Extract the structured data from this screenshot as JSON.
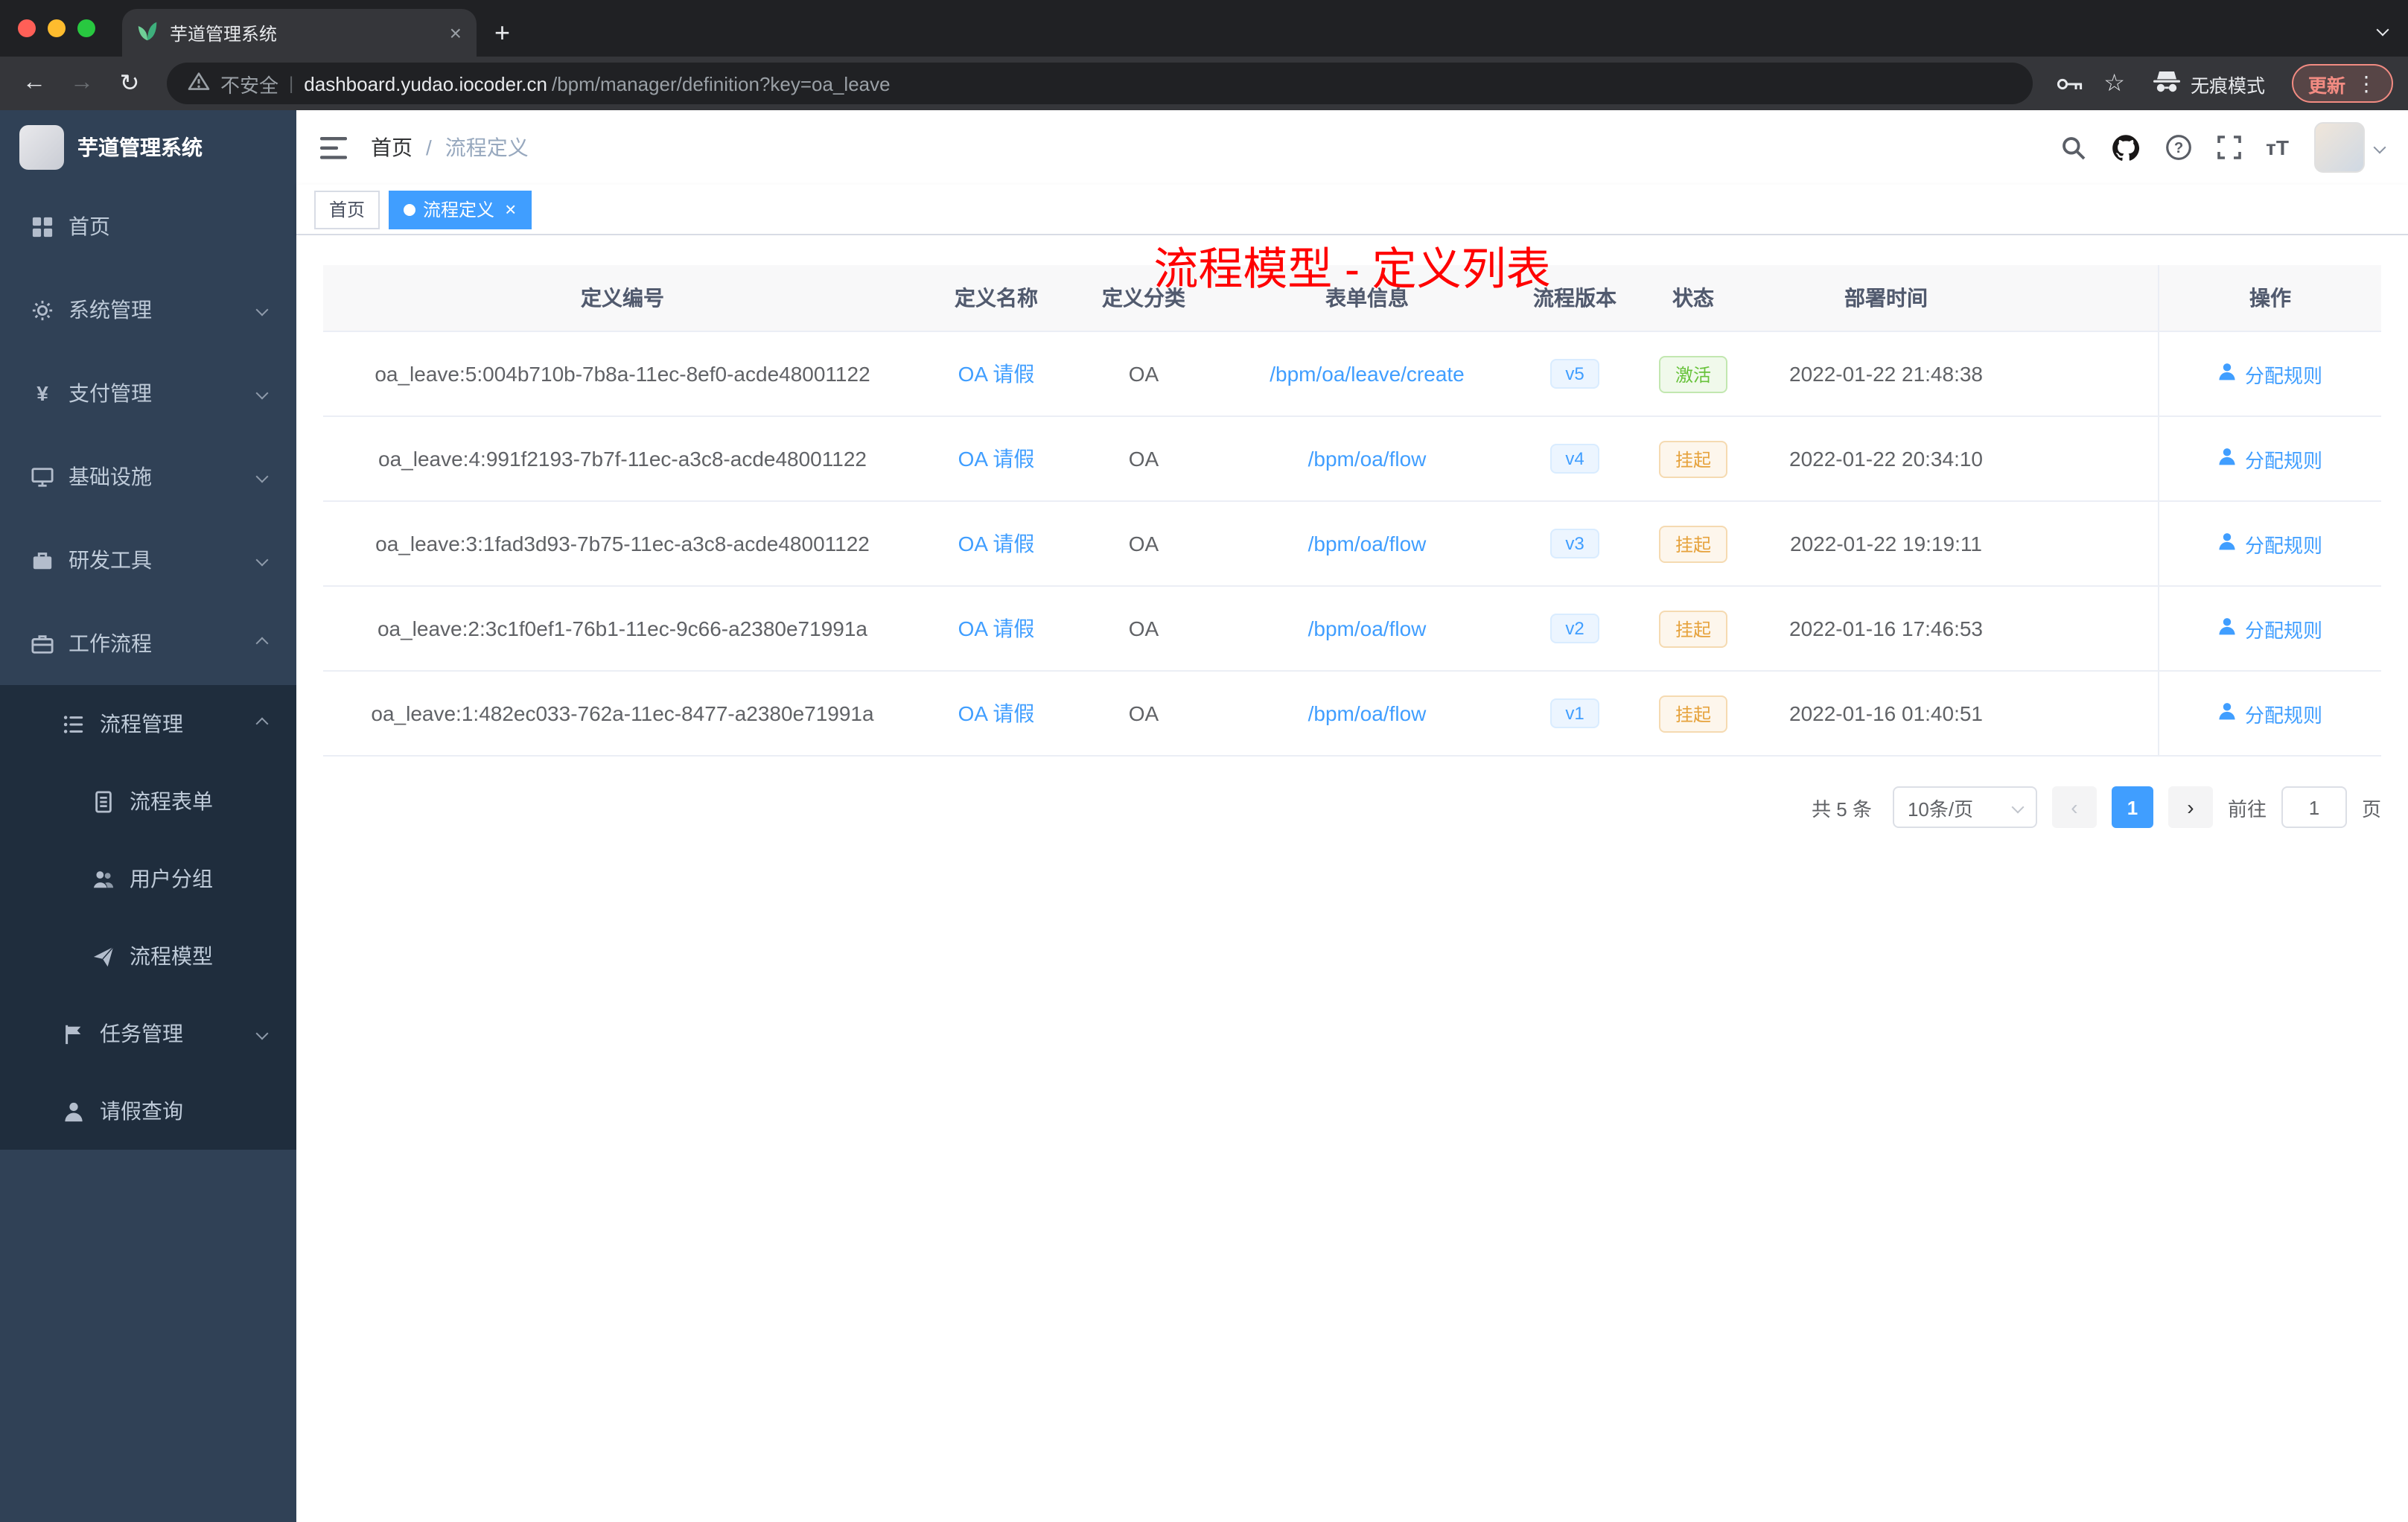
{
  "browser": {
    "tab_title": "芋道管理系统",
    "close_glyph": "×",
    "new_tab_glyph": "+",
    "back_glyph": "←",
    "forward_glyph": "→",
    "reload_glyph": "↻",
    "security_label": "不安全",
    "url_host": "dashboard.yudao.iocoder.cn",
    "url_path": "/bpm/manager/definition?key=oa_leave",
    "star_glyph": "☆",
    "incognito_label": "无痕模式",
    "update_label": "更新",
    "menu_dots_glyph": "⋮",
    "font_size_glyph": "тT"
  },
  "sidebar": {
    "logo_title": "芋道管理系统",
    "items": [
      {
        "label": "首页"
      },
      {
        "label": "系统管理"
      },
      {
        "label": "支付管理"
      },
      {
        "label": "基础设施"
      },
      {
        "label": "研发工具"
      },
      {
        "label": "工作流程"
      },
      {
        "label": "流程管理"
      },
      {
        "label": "流程表单"
      },
      {
        "label": "用户分组"
      },
      {
        "label": "流程模型"
      },
      {
        "label": "任务管理"
      },
      {
        "label": "请假查询"
      }
    ],
    "pay_icon_glyph": "¥"
  },
  "header": {
    "breadcrumb_home": "首页",
    "breadcrumb_sep": "/",
    "breadcrumb_current": "流程定义",
    "overlay_title": "流程模型 - 定义列表"
  },
  "tags": {
    "home": "首页",
    "active": "流程定义",
    "close_glyph": "×"
  },
  "table": {
    "columns": [
      "定义编号",
      "定义名称",
      "定义分类",
      "表单信息",
      "流程版本",
      "状态",
      "部署时间",
      "操作"
    ],
    "rows": [
      {
        "id": "oa_leave:5:004b710b-7b8a-11ec-8ef0-acde48001122",
        "name": "OA 请假",
        "category": "OA",
        "form": "/bpm/oa/leave/create",
        "version": "v5",
        "status": "激活",
        "time": "2022-01-22 21:48:38",
        "action": "分配规则"
      },
      {
        "id": "oa_leave:4:991f2193-7b7f-11ec-a3c8-acde48001122",
        "name": "OA 请假",
        "category": "OA",
        "form": "/bpm/oa/flow",
        "version": "v4",
        "status": "挂起",
        "time": "2022-01-22 20:34:10",
        "action": "分配规则"
      },
      {
        "id": "oa_leave:3:1fad3d93-7b75-11ec-a3c8-acde48001122",
        "name": "OA 请假",
        "category": "OA",
        "form": "/bpm/oa/flow",
        "version": "v3",
        "status": "挂起",
        "time": "2022-01-22 19:19:11",
        "action": "分配规则"
      },
      {
        "id": "oa_leave:2:3c1f0ef1-76b1-11ec-9c66-a2380e71991a",
        "name": "OA 请假",
        "category": "OA",
        "form": "/bpm/oa/flow",
        "version": "v2",
        "status": "挂起",
        "time": "2022-01-16 17:46:53",
        "action": "分配规则"
      },
      {
        "id": "oa_leave:1:482ec033-762a-11ec-8477-a2380e71991a",
        "name": "OA 请假",
        "category": "OA",
        "form": "/bpm/oa/flow",
        "version": "v1",
        "status": "挂起",
        "time": "2022-01-16 01:40:51",
        "action": "分配规则"
      }
    ]
  },
  "pagination": {
    "total": "共 5 条",
    "page_size": "10条/页",
    "prev_glyph": "‹",
    "current": "1",
    "next_glyph": "›",
    "goto_prefix": "前往",
    "goto_value": "1",
    "goto_suffix": "页"
  },
  "colors": {
    "accent": "#409eff",
    "overlay_title_red": "#ff0000",
    "status_success": "#67c23a",
    "status_warning": "#e6a23c"
  }
}
